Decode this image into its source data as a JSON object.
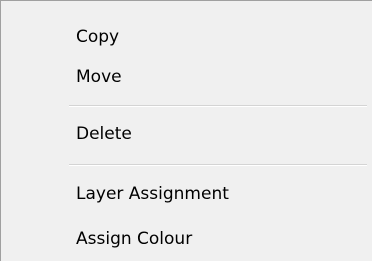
{
  "menu": {
    "items": [
      {
        "label": "Copy"
      },
      {
        "label": "Move"
      },
      {
        "label": "Delete"
      },
      {
        "label": "Layer Assignment"
      },
      {
        "label": "Assign Colour"
      }
    ]
  },
  "colors": {
    "menu_background": "#f0f0f0",
    "menu_border": "#a0a0a0",
    "separator": "#d4d4d4",
    "text": "#000000",
    "hover": "#91c9f7"
  }
}
